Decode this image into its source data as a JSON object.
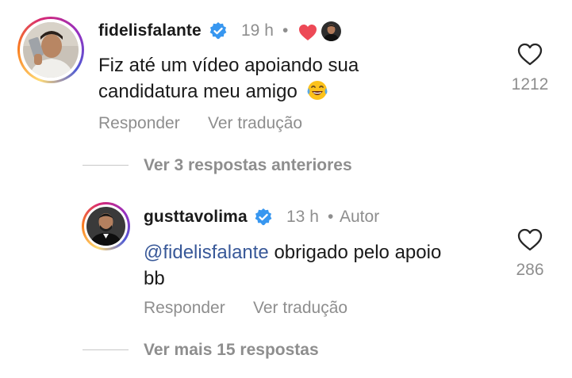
{
  "comments": [
    {
      "username": "fidelisfalante",
      "time": "19 h",
      "separator": "•",
      "text_line1": "Fiz até um vídeo apoiando sua",
      "text_line2": "candidatura meu amigo",
      "emoji": "😂",
      "like_count": "1212",
      "reply_label": "Responder",
      "translate_label": "Ver tradução"
    },
    {
      "username": "gusttavolima",
      "time": "13 h",
      "separator": "•",
      "author_label": "Autor",
      "mention": "@fidelisfalante",
      "text_rest": " obrigado pelo apoio",
      "text_line2": "bb",
      "like_count": "286",
      "reply_label": "Responder",
      "translate_label": "Ver tradução"
    }
  ],
  "threads": {
    "previous_replies": "Ver 3 respostas anteriores",
    "more_replies": "Ver mais 15 respostas"
  },
  "colors": {
    "verified_badge": "#3897f0",
    "liked_heart": "#ed4956",
    "mention": "#385898",
    "muted": "#8e8e8e"
  }
}
